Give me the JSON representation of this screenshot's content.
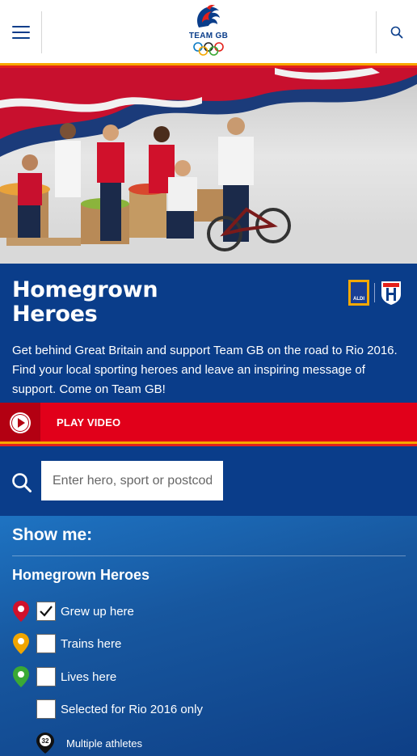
{
  "header": {
    "logo_text": "TEAM GB",
    "menu_icon": "hamburger-menu-icon",
    "search_icon": "search-icon"
  },
  "intro": {
    "title": "Homegrown Heroes",
    "description": "Get behind Great Britain and support Team GB on the road to Rio 2016. Find your local sporting heroes and leave an inspiring message of support. Come on Team GB!",
    "partner_logo_text": "ALDI"
  },
  "play": {
    "label": "PLAY VIDEO"
  },
  "search": {
    "placeholder": "Enter hero, sport or postcode",
    "value": ""
  },
  "filters": {
    "heading": "Show me:",
    "subheading": "Homegrown Heroes",
    "options": [
      {
        "label": "Grew up here",
        "checked": true,
        "pin_color": "#d0112b"
      },
      {
        "label": "Trains here",
        "checked": false,
        "pin_color": "#f0a500"
      },
      {
        "label": "Lives here",
        "checked": false,
        "pin_color": "#3aa935"
      },
      {
        "label": "Selected for Rio 2016 only",
        "checked": false,
        "pin_color": ""
      }
    ],
    "multiple": {
      "count": "32",
      "label": "Multiple athletes"
    }
  },
  "colors": {
    "navy": "#0a3d8a",
    "red": "#e1001a",
    "gold": "#f6a800"
  }
}
